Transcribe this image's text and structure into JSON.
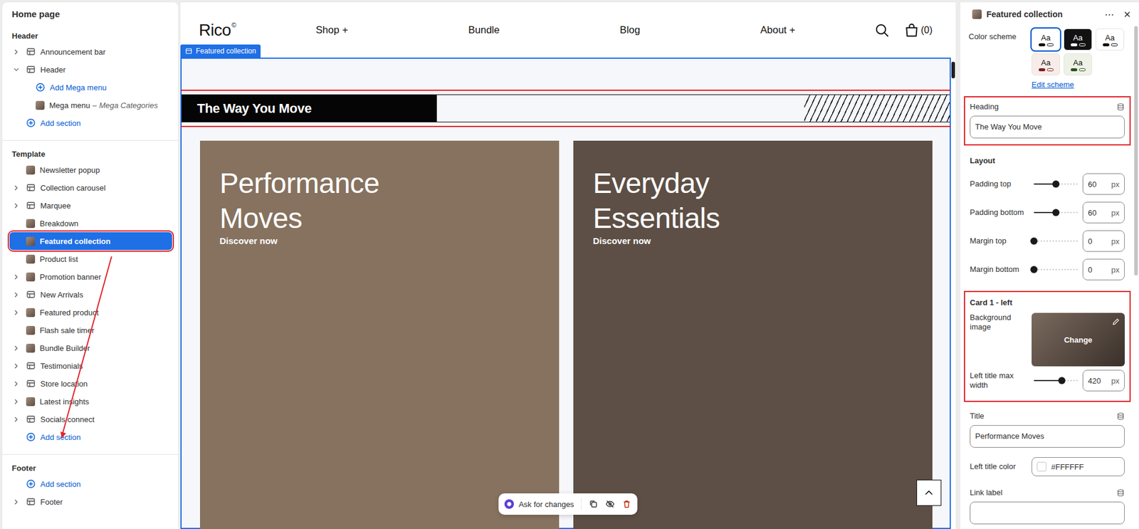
{
  "sidebar": {
    "title": "Home page",
    "groups": [
      {
        "label": "Header",
        "items": [
          {
            "kind": "section",
            "label": "Announcement bar",
            "expanded": false,
            "selected": false,
            "nested": false,
            "annotated": false
          },
          {
            "kind": "section",
            "label": "Header",
            "expanded": true,
            "selected": false,
            "nested": false,
            "annotated": false
          },
          {
            "kind": "add",
            "label": "Add Mega menu",
            "selected": false,
            "nested": true,
            "annotated": false
          },
          {
            "kind": "block",
            "label": "Mega menu",
            "separator": "–",
            "detail": "Mega Categories",
            "selected": false,
            "nested": true,
            "annotated": false
          },
          {
            "kind": "add",
            "label": "Add section",
            "selected": false,
            "nested": false,
            "annotated": false
          }
        ]
      },
      {
        "label": "Template",
        "items": [
          {
            "kind": "image",
            "label": "Newsletter popup",
            "selected": false,
            "nested": false,
            "annotated": false
          },
          {
            "kind": "section",
            "label": "Collection carousel",
            "expanded": false,
            "selected": false,
            "nested": false,
            "annotated": false
          },
          {
            "kind": "section",
            "label": "Marquee",
            "expanded": false,
            "selected": false,
            "nested": false,
            "annotated": false
          },
          {
            "kind": "image",
            "label": "Breakdown",
            "selected": false,
            "nested": false,
            "annotated": false
          },
          {
            "kind": "image",
            "label": "Featured collection",
            "selected": true,
            "nested": false,
            "annotated": true
          },
          {
            "kind": "image",
            "label": "Product list",
            "selected": false,
            "nested": false,
            "annotated": false
          },
          {
            "kind": "image",
            "label": "Promotion banner",
            "expanded": false,
            "selected": false,
            "nested": false,
            "annotated": false
          },
          {
            "kind": "section",
            "label": "New Arrivals",
            "expanded": false,
            "selected": false,
            "nested": false,
            "annotated": false
          },
          {
            "kind": "image",
            "label": "Featured product",
            "expanded": false,
            "selected": false,
            "nested": false,
            "annotated": false
          },
          {
            "kind": "image",
            "label": "Flash sale timer",
            "selected": false,
            "nested": false,
            "annotated": false
          },
          {
            "kind": "image",
            "label": "Bundle Builder",
            "expanded": false,
            "selected": false,
            "nested": false,
            "annotated": false
          },
          {
            "kind": "section",
            "label": "Testimonials",
            "expanded": false,
            "selected": false,
            "nested": false,
            "annotated": false
          },
          {
            "kind": "section",
            "label": "Store location",
            "expanded": false,
            "selected": false,
            "nested": false,
            "annotated": false
          },
          {
            "kind": "image",
            "label": "Latest insights",
            "expanded": false,
            "selected": false,
            "nested": false,
            "annotated": false
          },
          {
            "kind": "section",
            "label": "Socials connect",
            "expanded": false,
            "selected": false,
            "nested": false,
            "annotated": false
          },
          {
            "kind": "add",
            "label": "Add section",
            "selected": false,
            "nested": false,
            "annotated": false
          }
        ]
      },
      {
        "label": "Footer",
        "items": [
          {
            "kind": "add",
            "label": "Add section",
            "selected": false,
            "nested": false,
            "annotated": false
          },
          {
            "kind": "section",
            "label": "Footer",
            "expanded": false,
            "selected": false,
            "nested": false,
            "annotated": false
          }
        ]
      }
    ]
  },
  "preview": {
    "badge": "Featured collection",
    "nav": {
      "logo": "Rico",
      "logo_mark": "©",
      "links": [
        "Shop +",
        "Bundle",
        "Blog",
        "About +"
      ],
      "cart_count": "(0)"
    },
    "heading": {
      "text": "The Way You Move",
      "annotated": true
    },
    "cards": [
      {
        "title": "Performance Moves",
        "link": "Discover now"
      },
      {
        "title": "Everyday Essentials",
        "link": "Discover now"
      }
    ],
    "toolbar": {
      "ask": "Ask for changes"
    }
  },
  "settings": {
    "title": "Featured collection",
    "more": "⋯",
    "close": "×",
    "color_scheme": {
      "label": "Color scheme",
      "swatches": [
        {
          "label": "Aa",
          "color": "#ffffff",
          "accent": "#121212",
          "selected": true
        },
        {
          "label": "Aa",
          "color": "#121212",
          "accent": "#ffffff",
          "selected": false
        },
        {
          "label": "Aa",
          "color": "#ffffff",
          "accent": "#121212",
          "selected": false
        },
        {
          "label": "Aa",
          "color": "#f8ece9",
          "accent": "#7a1f1f",
          "selected": false
        },
        {
          "label": "Aa",
          "color": "#eef2e6",
          "accent": "#2f4f1f",
          "selected": false
        }
      ],
      "edit": "Edit scheme"
    },
    "heading": {
      "label": "Heading",
      "value": "The Way You Move",
      "annotated": true
    },
    "layout": {
      "title": "Layout",
      "sliders": [
        {
          "label": "Padding top",
          "value": "60",
          "unit": "px",
          "level": 0.5
        },
        {
          "label": "Padding bottom",
          "value": "60",
          "unit": "px",
          "level": 0.5
        },
        {
          "label": "Margin top",
          "value": "0",
          "unit": "px",
          "level": 0
        },
        {
          "label": "Margin bottom",
          "value": "0",
          "unit": "px",
          "level": 0
        }
      ]
    },
    "card": {
      "title": "Card 1 - left",
      "annotated": true,
      "image": {
        "label": "Background image",
        "action": "Change"
      },
      "slider": {
        "label": "Left title max width",
        "value": "420",
        "unit": "px",
        "level": 0.64
      }
    },
    "fields": [
      {
        "kind": "text",
        "label": "Title",
        "value": "Performance Moves"
      },
      {
        "kind": "color",
        "label": "Left title color",
        "value": "#FFFFFF"
      },
      {
        "kind": "text",
        "label": "Link label",
        "value": ""
      }
    ]
  }
}
